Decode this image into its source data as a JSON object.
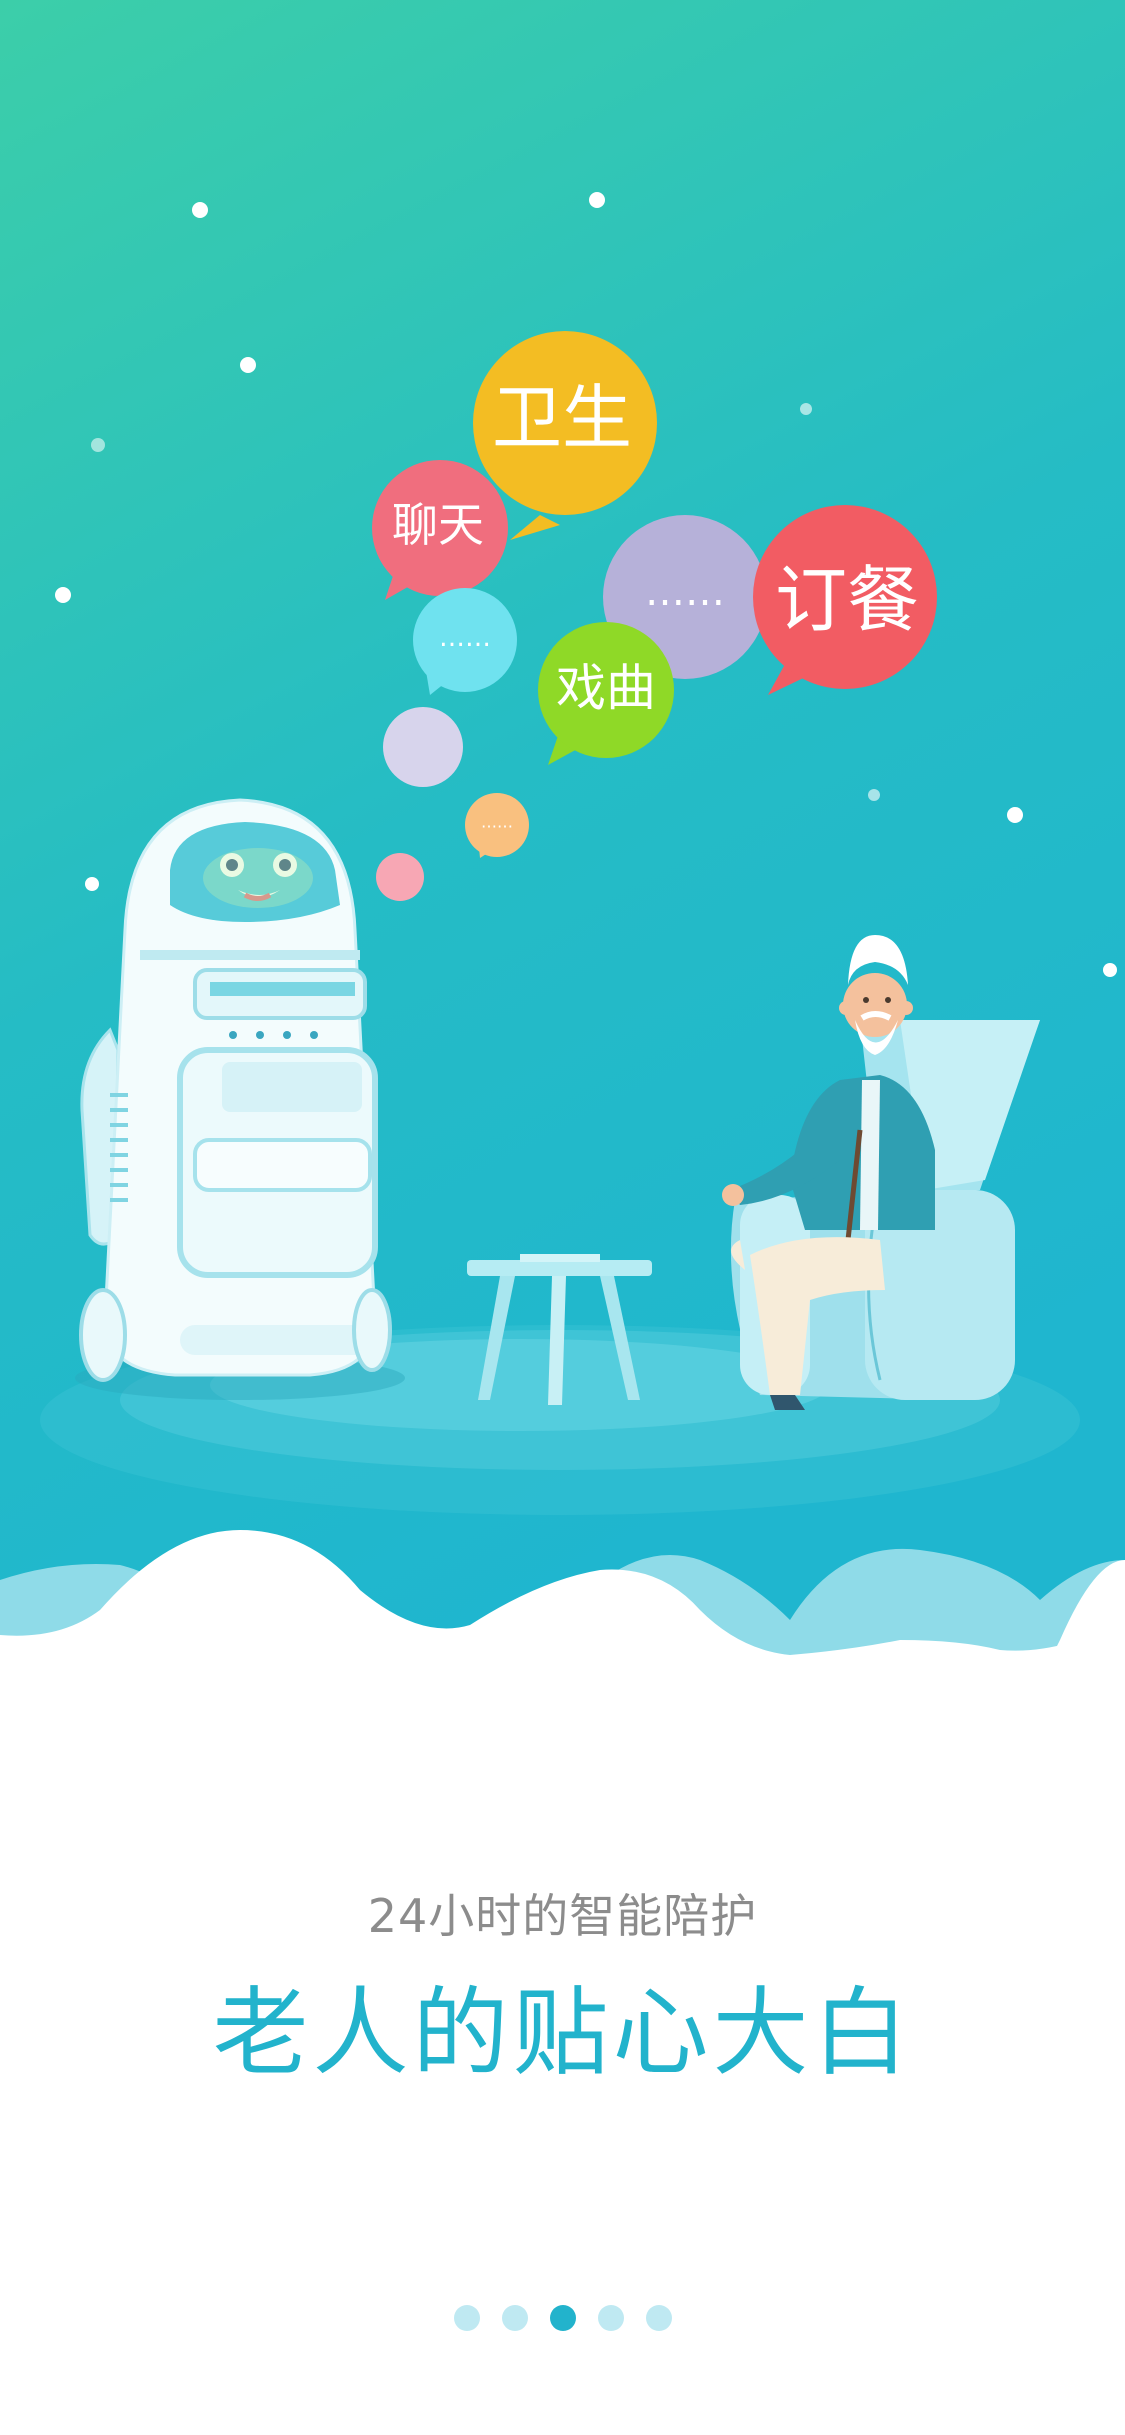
{
  "bubbles": {
    "hygiene": "卫生",
    "chat": "聊天",
    "order_meal": "订餐",
    "opera": "戏曲",
    "more_purple": "……",
    "more_cyan": "……",
    "more_orange": "……"
  },
  "subtitle": "24小时的智能陪护",
  "headline": "老人的贴心大白",
  "pager": {
    "total": 5,
    "active_index": 2
  },
  "colors": {
    "bg_top": "#3ccea9",
    "bg_bottom": "#1fb6cf",
    "accent": "#22b3cc",
    "bubble_yellow": "#f3bd23",
    "bubble_pink": "#f06e7e",
    "bubble_red": "#f25c63",
    "bubble_green": "#8fd927",
    "bubble_purple": "#b6b1d9",
    "bubble_cyan": "#6fe2ef",
    "bubble_orange": "#f9c07f"
  }
}
